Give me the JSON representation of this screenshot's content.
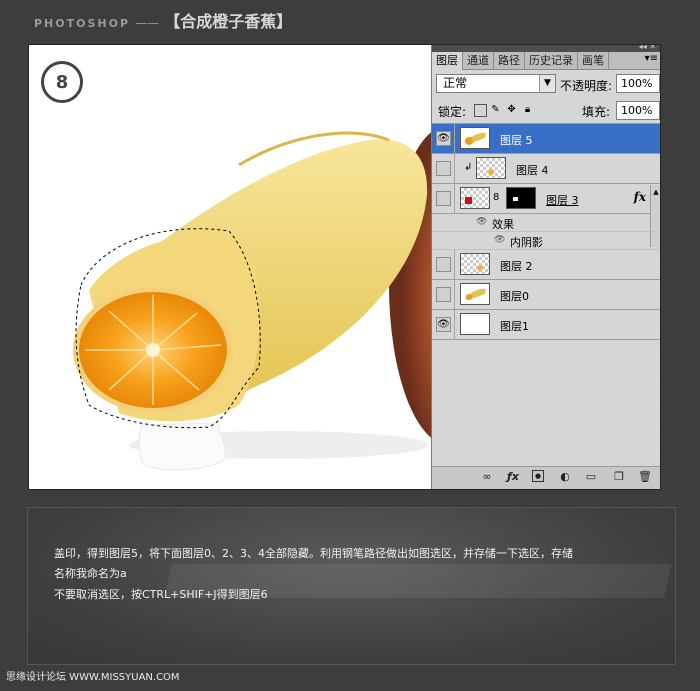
{
  "header": {
    "brand": "PHOTOSHOP",
    "separator": "——",
    "title": "【合成橙子香蕉】"
  },
  "step_badge": "8",
  "panel": {
    "tabs": [
      "图层",
      "通道",
      "路径",
      "历史记录",
      "画笔"
    ],
    "blend_mode": "正常",
    "opacity_label": "不透明度:",
    "opacity_value": "100%",
    "lock_label": "锁定:",
    "fill_label": "填充:",
    "fill_value": "100%",
    "layers": [
      {
        "name": "图层 5",
        "visible": true,
        "selected": true
      },
      {
        "name": "图层 4",
        "visible": false,
        "clipped": true
      },
      {
        "name": "图层 3",
        "visible": false,
        "has_mask": true,
        "fx": "fx"
      },
      {
        "name": "图层 2",
        "visible": false
      },
      {
        "name": "图层0",
        "visible": false
      },
      {
        "name": "图层1",
        "visible": true
      }
    ],
    "effects_label": "效果",
    "inner_shadow_label": "内阴影"
  },
  "instructions": [
    "盖印，得到图层5，将下面图层0、2、3、4全部隐藏。利用钢笔路径做出如图选区，并存储一下选区，存储",
    "名称我命名为a",
    "不要取消选区，按CTRL+SHIF+J得到图层6"
  ],
  "footer": "思缘设计论坛 WWW.MISSYUAN.COM",
  "colors": {
    "selected_layer": "#3a6fc7",
    "orange": "#f39a16",
    "banana": "#f2d66b"
  }
}
